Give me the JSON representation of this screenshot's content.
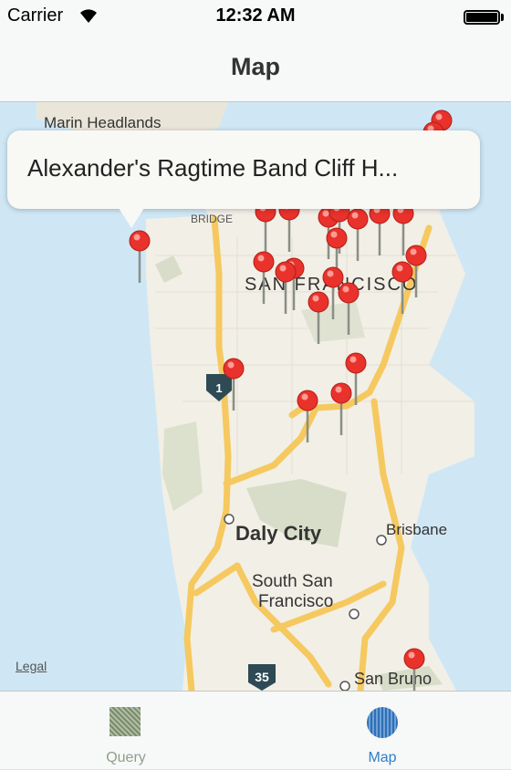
{
  "status_bar": {
    "carrier": "Carrier",
    "time": "12:32 AM"
  },
  "nav": {
    "title": "Map"
  },
  "map": {
    "labels": {
      "marin": "Marin Headlands",
      "bridge": "BRIDGE",
      "sf": "SAN FRANCISCO",
      "daly": "Daly City",
      "brisbane": "Brisbane",
      "ssf1": "South San",
      "ssf2": "Francisco",
      "sanbruno": "San Bruno",
      "route1": "1",
      "route35": "35"
    },
    "legal": "Legal",
    "callout": {
      "title": "Alexander's Ragtime Band Cliff H..."
    }
  },
  "tabs": [
    {
      "label": "Query",
      "icon": "query-icon",
      "color": "#7a8a6e"
    },
    {
      "label": "Map",
      "icon": "map-icon",
      "color": "#2f80c8"
    }
  ]
}
